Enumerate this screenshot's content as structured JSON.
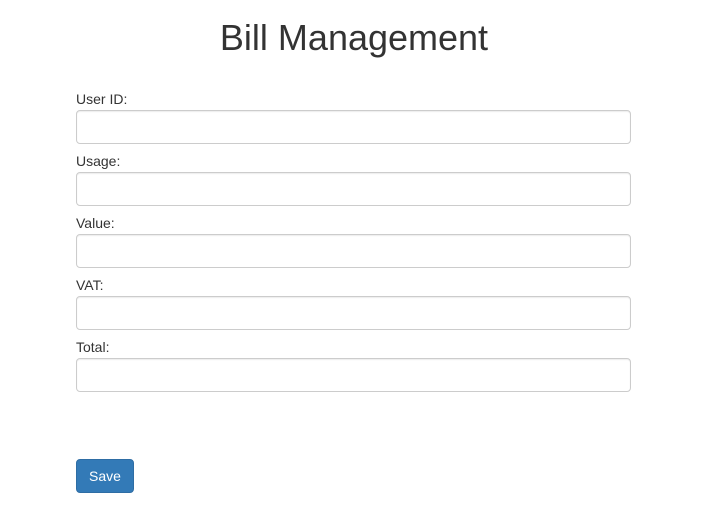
{
  "header": {
    "title": "Bill Management"
  },
  "form": {
    "fields": [
      {
        "label": "User ID:",
        "value": "",
        "placeholder": ""
      },
      {
        "label": "Usage:",
        "value": "",
        "placeholder": ""
      },
      {
        "label": "Value:",
        "value": "",
        "placeholder": ""
      },
      {
        "label": "VAT:",
        "value": "",
        "placeholder": ""
      },
      {
        "label": "Total:",
        "value": "",
        "placeholder": ""
      }
    ],
    "save_label": "Save"
  },
  "colors": {
    "primary_button": "#337ab7",
    "primary_button_border": "#2e6da4",
    "input_border": "#cccccc",
    "text": "#333333"
  }
}
